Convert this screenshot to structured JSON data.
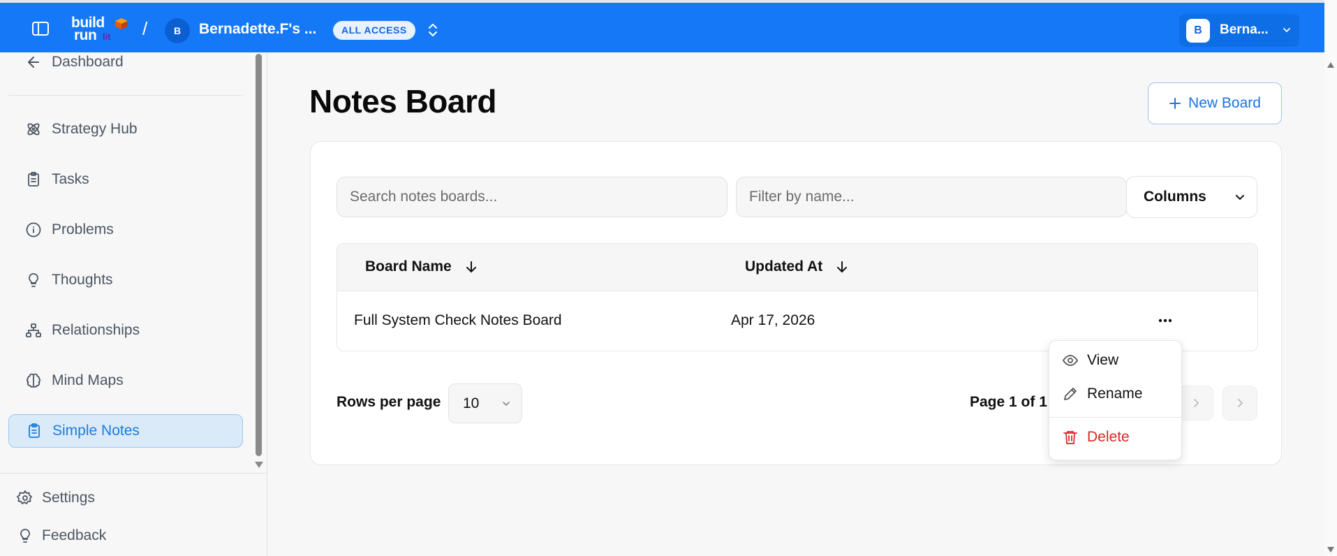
{
  "header": {
    "logo_line1": "build",
    "logo_line2": "run",
    "logo_line3": "lit",
    "separator": "/",
    "workspace_initial": "B",
    "workspace_name": "Bernadette.F's ...",
    "access_badge": "ALL ACCESS",
    "user_initial": "B",
    "user_name": "Berna..."
  },
  "sidebar": {
    "back_label": "Dashboard",
    "items": [
      {
        "label": "Strategy Hub",
        "icon": "atom-icon"
      },
      {
        "label": "Tasks",
        "icon": "clipboard-icon"
      },
      {
        "label": "Problems",
        "icon": "info-icon"
      },
      {
        "label": "Thoughts",
        "icon": "lightbulb-icon"
      },
      {
        "label": "Relationships",
        "icon": "network-icon"
      },
      {
        "label": "Mind Maps",
        "icon": "brain-icon"
      },
      {
        "label": "Simple Notes",
        "icon": "notes-icon",
        "active": true
      }
    ],
    "settings_label": "Settings",
    "feedback_label": "Feedback"
  },
  "main": {
    "title": "Notes Board",
    "new_board_label": "New Board",
    "search_placeholder": "Search notes boards...",
    "filter_placeholder": "Filter by name...",
    "columns_label": "Columns",
    "table": {
      "headers": [
        "Board Name",
        "Updated At"
      ],
      "rows": [
        {
          "board_name": "Full System Check Notes Board",
          "updated_at": "Apr 17, 2026"
        }
      ]
    },
    "rows_per_page_label": "Rows per page",
    "rows_per_page_value": "10",
    "page_info": "Page 1 of 1"
  },
  "row_menu": {
    "view_label": "View",
    "rename_label": "Rename",
    "delete_label": "Delete"
  },
  "colors": {
    "primary": "#1579f7",
    "active_bg": "#dbeaf9",
    "danger": "#dc2626"
  }
}
